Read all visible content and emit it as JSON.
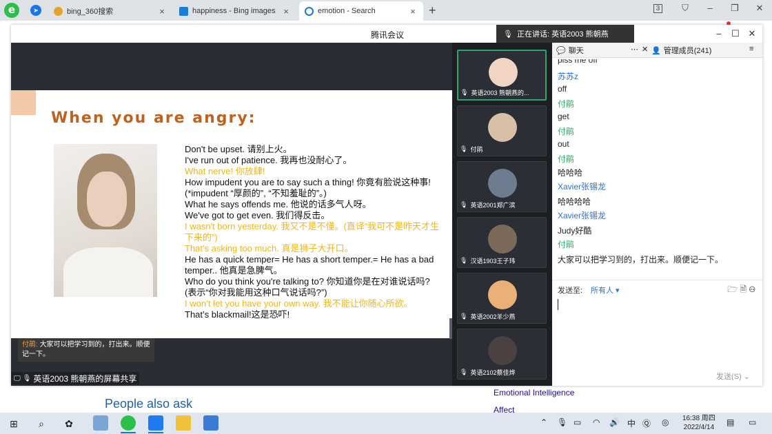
{
  "browser": {
    "tabs": [
      {
        "label": "bing_360搜索",
        "close": "×"
      },
      {
        "label": "happiness - Bing images",
        "close": "×"
      },
      {
        "label": "emotion - Search",
        "close": "×"
      }
    ],
    "new_tab": "+",
    "window_controls": [
      "3",
      "⛉",
      "–",
      "❐",
      "✕"
    ]
  },
  "page_behind": {
    "people_also_ask": "People also ask",
    "links": [
      "Emotional Intelligence",
      "Affect"
    ]
  },
  "meeting": {
    "title": "腾讯会议",
    "speaking": "正在讲话: 英语2003 熊朝燕",
    "controls": [
      "–",
      "☐",
      "✕"
    ],
    "slide": {
      "title": "When you are angry:",
      "lines": [
        {
          "text": "Don't be upset. 请别上火。",
          "hl": false
        },
        {
          "text": "I've run out of patience. 我再也没耐心了。",
          "hl": false
        },
        {
          "text": "What nerve! 你放肆!",
          "hl": true
        },
        {
          "text": "How impudent you are to say such a thing! 你竟有脸说这种事! (*impudent “厚颜的”, “不知羞耻的”。)",
          "hl": false
        },
        {
          "text": "What he says offends me. 他说的话多气人呀。",
          "hl": false
        },
        {
          "text": "We've got to get even. 我们得反击。",
          "hl": false
        },
        {
          "text": "I wasn't born yesterday. 我又不是不懂。(直译“我可不是昨天才生下来的”)",
          "hl": true
        },
        {
          "text": "That's asking too much. 真是狮子大开口。",
          "hl": true
        },
        {
          "text": "He has a quick temper= He has a short temper.= He has a bad temper.. 他真是急脾气。",
          "hl": false
        },
        {
          "text": "Who do you think you're talking to? 你知道你是在对谁说话吗? (表示“你对我能用这种口气说话吗?”)",
          "hl": false
        },
        {
          "text": "I won’t let you have your own way. 我不能让你随心所欲。",
          "hl": true
        },
        {
          "text": "That’s blackmail!这是恐吓!",
          "hl": false
        }
      ],
      "subtitle_name": "付鹃:",
      "subtitle_text": "大家可以把学习到的，打出来。顺便记一下。"
    },
    "share_label": "英语2003 熊朝燕的屏幕共享",
    "participants": [
      {
        "name": "英语2003 熊朝燕的...",
        "color": "#f1d4c3"
      },
      {
        "name": "付鹃",
        "color": "#d8c0a8"
      },
      {
        "name": "英语2001郑广滨",
        "color": "#6d7c8f"
      },
      {
        "name": "汉语1903王子玮",
        "color": "#7b6a5a"
      },
      {
        "name": "英语2002羊少燕",
        "color": "#e9b078"
      },
      {
        "name": "英语2102蔡佳烨",
        "color": "#4a4140"
      }
    ],
    "chat": {
      "tab_chat": "聊天",
      "tab_members": "管理成员(241)",
      "messages": [
        {
          "t": "piss me off",
          "kind": "text"
        },
        {
          "t": "苏苏z",
          "kind": "sender-b"
        },
        {
          "t": "off",
          "kind": "text"
        },
        {
          "t": "付鹃",
          "kind": "sender-g"
        },
        {
          "t": "get",
          "kind": "text"
        },
        {
          "t": "付鹃",
          "kind": "sender-g"
        },
        {
          "t": "out",
          "kind": "text"
        },
        {
          "t": "付鹃",
          "kind": "sender-g"
        },
        {
          "t": "哈哈哈",
          "kind": "text"
        },
        {
          "t": "Xavier张锡龙",
          "kind": "sender-b"
        },
        {
          "t": "哈哈哈哈",
          "kind": "text"
        },
        {
          "t": "Xavier张锡龙",
          "kind": "sender-b"
        },
        {
          "t": "Judy好酷",
          "kind": "text"
        },
        {
          "t": "付鹃",
          "kind": "sender-g"
        },
        {
          "t": "大家可以把学习到的，打出来。顺便记一下。",
          "kind": "text"
        }
      ],
      "send_to_label": "发送至:",
      "send_to_value": "所有人",
      "send_button": "发送(S)"
    }
  },
  "taskbar": {
    "time": "16:38 周四",
    "date": "2022/4/14"
  }
}
